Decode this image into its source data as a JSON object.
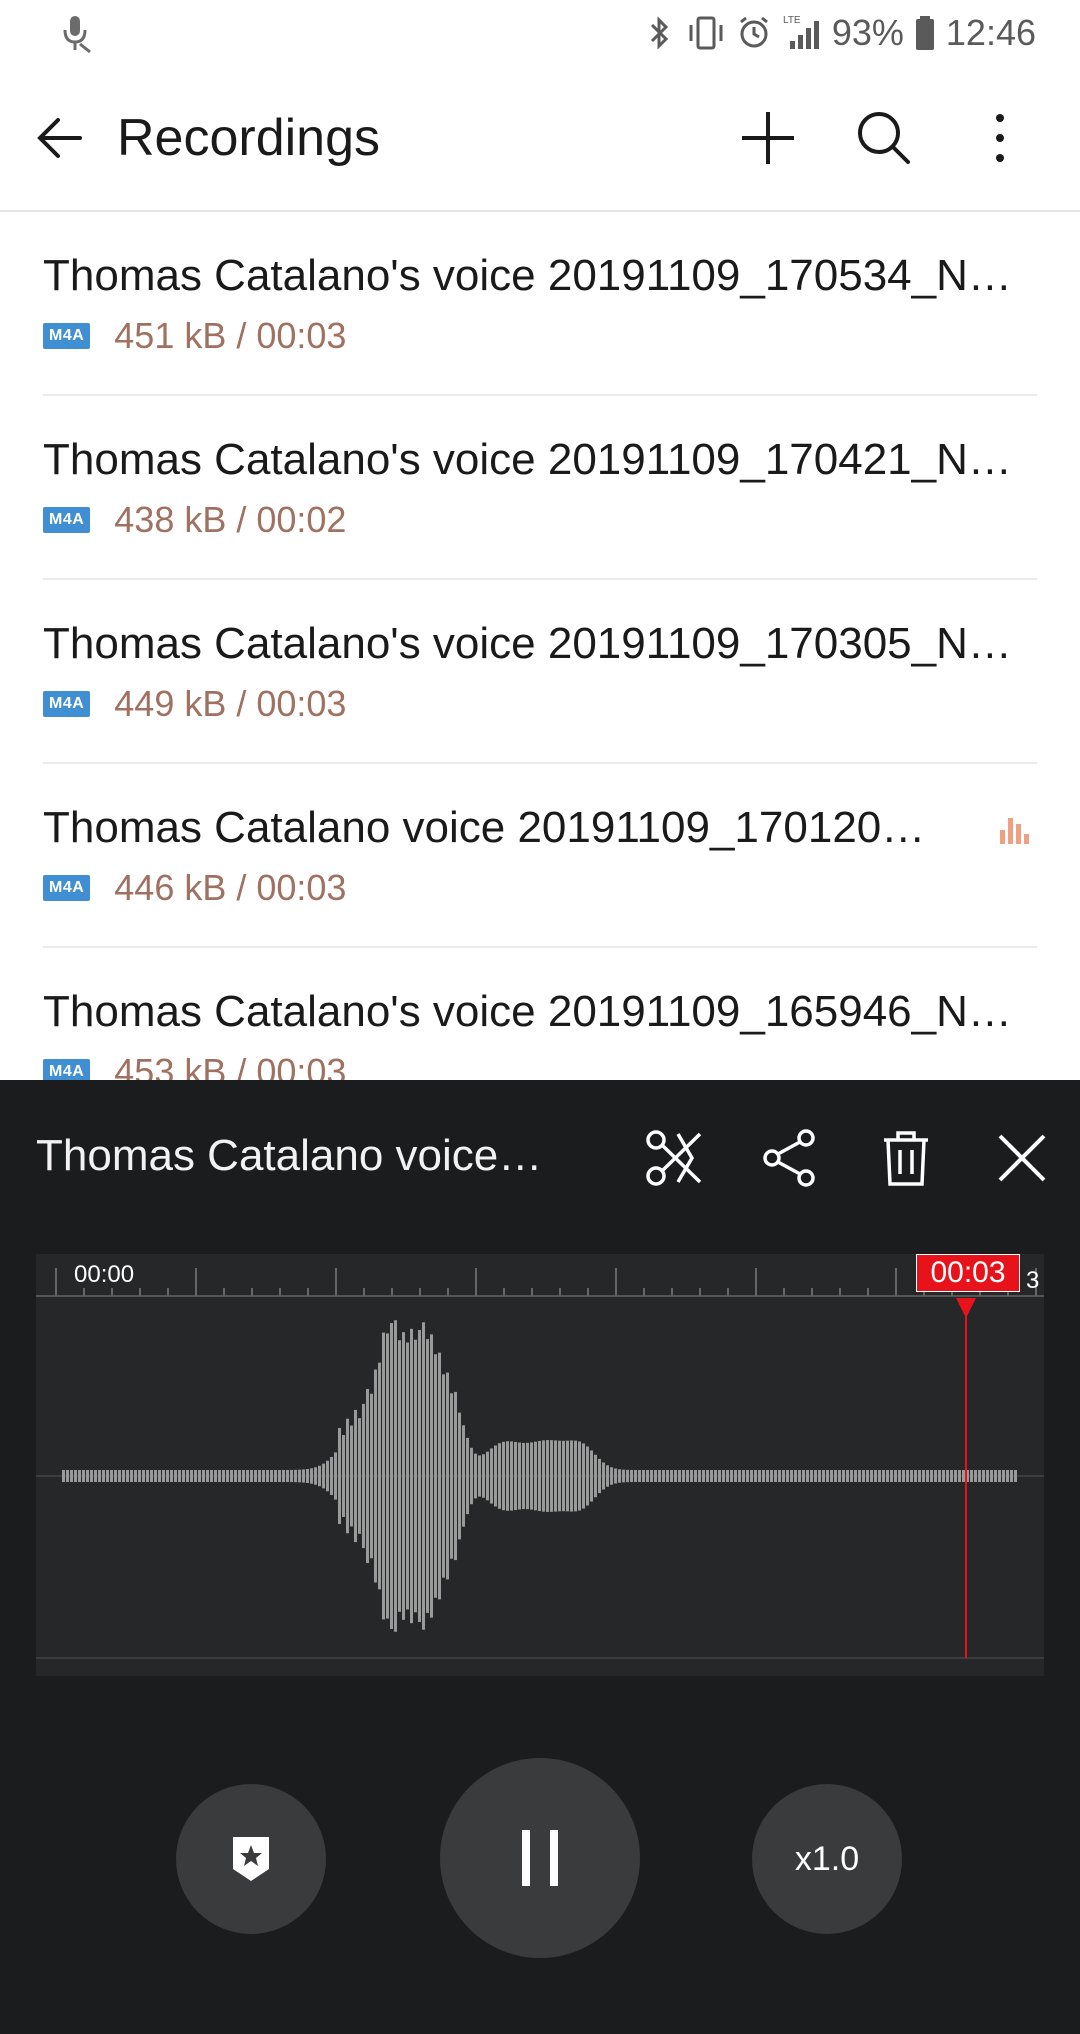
{
  "status_bar": {
    "battery": "93%",
    "time": "12:46",
    "network": "LTE",
    "icons": [
      "mic-icon",
      "bluetooth-icon",
      "vibrate-icon",
      "alarm-icon",
      "signal-icon",
      "battery-icon"
    ]
  },
  "app_bar": {
    "title": "Recordings",
    "actions": [
      "add-icon",
      "search-icon",
      "more-options-icon"
    ]
  },
  "recordings": [
    {
      "name": "Thomas Catalano's voice 20191109_170534_N…",
      "format": "M4A",
      "info": "451 kB / 00:03",
      "playing": false
    },
    {
      "name": "Thomas Catalano's voice 20191109_170421_N…",
      "format": "M4A",
      "info": "438 kB / 00:02",
      "playing": false
    },
    {
      "name": "Thomas Catalano's voice 20191109_170305_N…",
      "format": "M4A",
      "info": "449 kB / 00:03",
      "playing": false
    },
    {
      "name": "Thomas Catalano voice 20191109_170120…",
      "format": "M4A",
      "info": "446 kB / 00:03",
      "playing": true
    },
    {
      "name": "Thomas Catalano's voice 20191109_165946_N…",
      "format": "M4A",
      "info": "453 kB / 00:03",
      "playing": false
    }
  ],
  "player": {
    "title": "Thomas Catalano voice…",
    "actions": [
      "trim-icon",
      "share-icon",
      "delete-icon",
      "close-icon"
    ],
    "timeline_start": "00:00",
    "timeline_end_fragment": "3",
    "current_time": "00:03",
    "speed": "x1.0",
    "accent_color": "#e8131a"
  }
}
